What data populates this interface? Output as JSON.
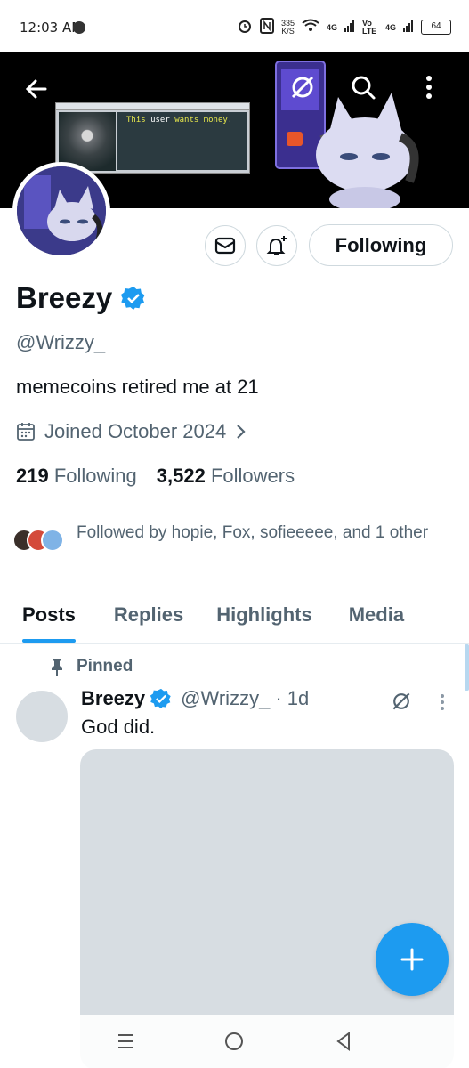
{
  "status_bar": {
    "time": "12:03 AM",
    "speed_value": "335",
    "speed_unit": "K/S",
    "network_1": "4G",
    "network_2": "Vo LTE",
    "network_3": "4G",
    "battery": "64"
  },
  "banner": {
    "terminal_text_prefix": "This ",
    "terminal_text_word": "user",
    "terminal_text_suffix": " wants money."
  },
  "profile": {
    "name": "Breezy",
    "handle": "@Wrizzy_",
    "bio": "memecoins retired me at 21",
    "joined": "Joined October 2024",
    "following_count": "219",
    "following_label": "Following",
    "followers_count": "3,522",
    "followers_label": "Followers",
    "followed_by": "Followed by hopie, Fox, sofieeeee, and 1 other",
    "follow_button": "Following",
    "verified_color": "#1d9bf0"
  },
  "tabs": [
    {
      "label": "Posts",
      "active": true
    },
    {
      "label": "Replies",
      "active": false
    },
    {
      "label": "Highlights",
      "active": false
    },
    {
      "label": "Media",
      "active": false
    }
  ],
  "post": {
    "pinned_label": "Pinned",
    "author": "Breezy",
    "handle": "@Wrizzy_",
    "time": "· 1d",
    "text": "God did."
  },
  "colors": {
    "accent": "#1d9bf0",
    "secondary_text": "#536471"
  }
}
